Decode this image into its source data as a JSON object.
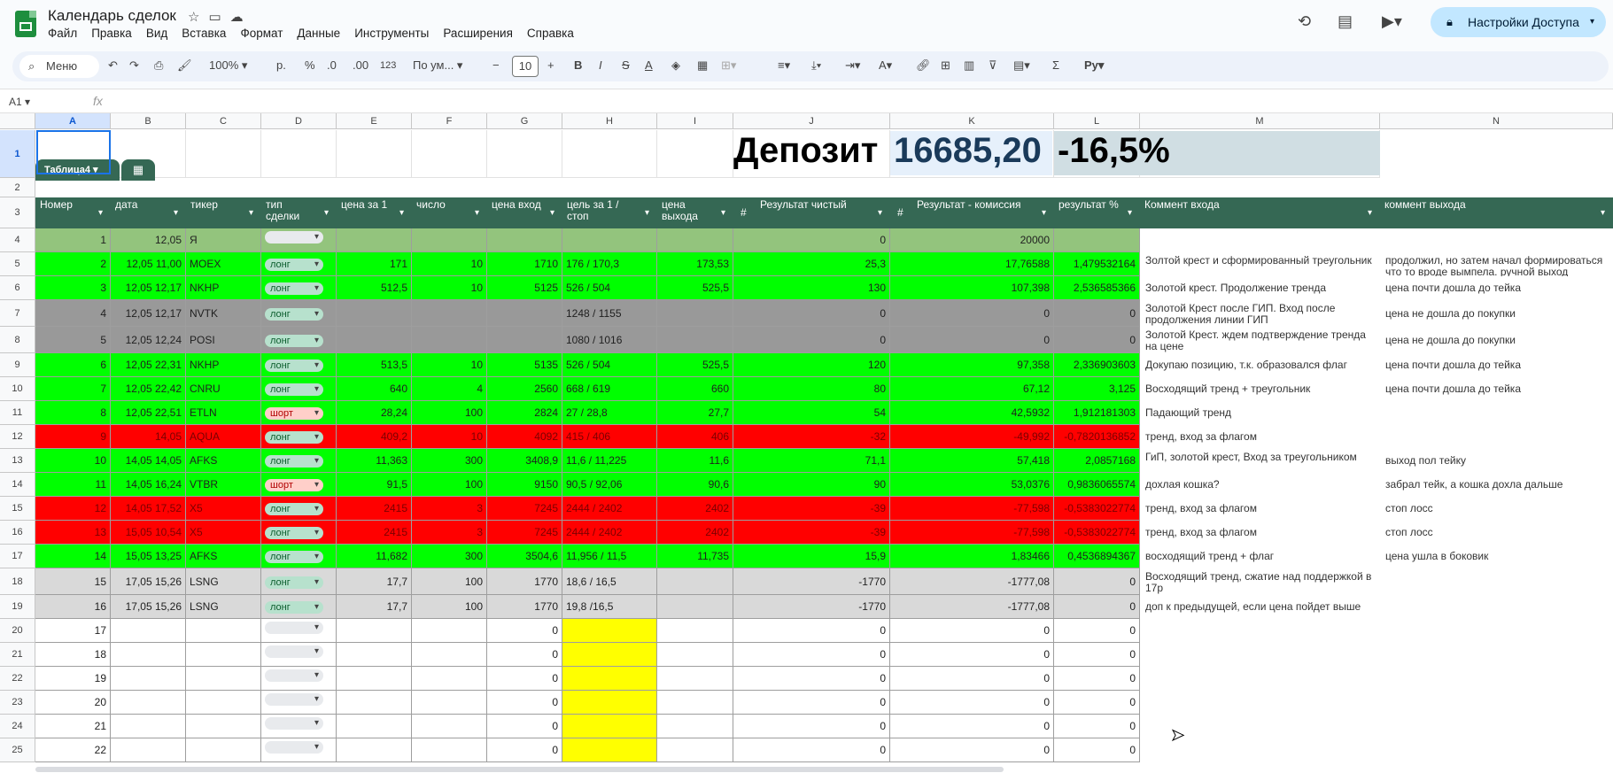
{
  "app": {
    "doc_title": "Календарь сделок",
    "menu": [
      "Файл",
      "Правка",
      "Вид",
      "Вставка",
      "Формат",
      "Данные",
      "Инструменты",
      "Расширения",
      "Справка"
    ],
    "share_label": "Настройки Доступа"
  },
  "toolbar": {
    "search_label": "Меню",
    "zoom": "100%",
    "currency": "р.",
    "percent": "%",
    "dec_dec": ".0",
    "dec_inc": ".00",
    "format_123": "123",
    "font": "По ум...",
    "font_size": "10"
  },
  "formula_bar": {
    "name_box": "A1",
    "fx": "fx"
  },
  "columns": [
    "A",
    "B",
    "C",
    "D",
    "E",
    "F",
    "G",
    "H",
    "I",
    "J",
    "K",
    "L",
    "M",
    "N"
  ],
  "row_numbers": [
    "1",
    "2",
    "3",
    "4",
    "5",
    "6",
    "7",
    "8",
    "9",
    "10",
    "11",
    "12",
    "13",
    "14",
    "15",
    "16",
    "17",
    "18",
    "19",
    "20",
    "21",
    "22",
    "23",
    "24",
    "25"
  ],
  "summary": {
    "deposit_label": "Депозит",
    "deposit_value": "16685,20",
    "deposit_pct": "-16,5%"
  },
  "table": {
    "name": "Таблица4",
    "headers": [
      "Номер",
      "дата",
      "тикер",
      "тип сделки",
      "цена за 1",
      "число",
      "цена вход",
      "цель за 1 / стоп",
      "цена выхода",
      "Результат чистый",
      "Результат - комиссия",
      "результат %",
      "Коммент входа",
      "коммент выхода"
    ],
    "rows": [
      {
        "n": "1",
        "date": "12,05",
        "ticker": "Я",
        "type": "",
        "price": "",
        "qty": "",
        "entry": "",
        "target": "",
        "exit": "",
        "net": "0",
        "fee": "20000",
        "pct": "",
        "c_in": "",
        "c_out": "",
        "color": "#93c47d"
      },
      {
        "n": "2",
        "date": "12,05 11,00",
        "ticker": "MOEX",
        "type": "лонг",
        "price": "171",
        "qty": "10",
        "entry": "1710",
        "target": "176 / 170,3",
        "exit": "173,53",
        "net": "25,3",
        "fee": "17,76588",
        "pct": "1,479532164",
        "c_in": "Золтой крест и сформированный треугольник",
        "c_out": "продолжил, но затем начал формироваться что то вроде вымпела. ручной выход",
        "color": "#00ff00"
      },
      {
        "n": "3",
        "date": "12,05 12,17",
        "ticker": "NKHP",
        "type": "лонг",
        "price": "512,5",
        "qty": "10",
        "entry": "5125",
        "target": "526 / 504",
        "exit": "525,5",
        "net": "130",
        "fee": "107,398",
        "pct": "2,536585366",
        "c_in": "Золотой крест. Продолжение тренда",
        "c_out": "цена почти дошла до тейка",
        "color": "#00ff00"
      },
      {
        "n": "4",
        "date": "12,05 12,17",
        "ticker": "NVTK",
        "type": "лонг",
        "price": "",
        "qty": "",
        "entry": "",
        "target": "1248 / 1155",
        "exit": "",
        "net": "0",
        "fee": "0",
        "pct": "0",
        "c_in": "Золотой Крест после ГИП. Вход после продолжения линии ГИП",
        "c_out": "цена не дошла до покупки",
        "color": "#999999"
      },
      {
        "n": "5",
        "date": "12,05 12,24",
        "ticker": "POSI",
        "type": "лонг",
        "price": "",
        "qty": "",
        "entry": "",
        "target": "1080 / 1016",
        "exit": "",
        "net": "0",
        "fee": "0",
        "pct": "0",
        "c_in": "Золотой Крест. ждем подтверждение тренда на цене",
        "c_out": "цена не дошла до покупки",
        "color": "#999999"
      },
      {
        "n": "6",
        "date": "12,05 22,31",
        "ticker": "NKHP",
        "type": "лонг",
        "price": "513,5",
        "qty": "10",
        "entry": "5135",
        "target": "526 / 504",
        "exit": "525,5",
        "net": "120",
        "fee": "97,358",
        "pct": "2,336903603",
        "c_in": "Докупаю позицию, т.к. образовался флаг",
        "c_out": "цена почти дошла до тейка",
        "color": "#00ff00"
      },
      {
        "n": "7",
        "date": "12,05 22,42",
        "ticker": "CNRU",
        "type": "лонг",
        "price": "640",
        "qty": "4",
        "entry": "2560",
        "target": "668 / 619",
        "exit": "660",
        "net": "80",
        "fee": "67,12",
        "pct": "3,125",
        "c_in": "Восходящий тренд + треугольник",
        "c_out": "цена почти дошла до тейка",
        "color": "#00ff00"
      },
      {
        "n": "8",
        "date": "12,05 22,51",
        "ticker": "ETLN",
        "type": "шорт",
        "price": "28,24",
        "qty": "100",
        "entry": "2824",
        "target": "27 / 28,8",
        "exit": "27,7",
        "net": "54",
        "fee": "42,5932",
        "pct": "1,912181303",
        "c_in": "Падающий тренд",
        "c_out": "",
        "color": "#00ff00"
      },
      {
        "n": "9",
        "date": "14,05",
        "ticker": "AQUA",
        "type": "лонг",
        "price": "409,2",
        "qty": "10",
        "entry": "4092",
        "target": "415 / 406",
        "exit": "406",
        "net": "-32",
        "fee": "-49,992",
        "pct": "-0,7820136852",
        "c_in": "тренд, вход за флагом",
        "c_out": "",
        "color": "#ff0000"
      },
      {
        "n": "10",
        "date": "14,05 14,05",
        "ticker": "AFKS",
        "type": "лонг",
        "price": "11,363",
        "qty": "300",
        "entry": "3408,9",
        "target": "11,6 / 11,225",
        "exit": "11,6",
        "net": "71,1",
        "fee": "57,418",
        "pct": "2,0857168",
        "c_in": "ГиП, золотой крест, Вход за треугольником",
        "c_out": "выход пол тейку",
        "color": "#00ff00"
      },
      {
        "n": "11",
        "date": "14,05 16,24",
        "ticker": "VTBR",
        "type": "шорт",
        "price": "91,5",
        "qty": "100",
        "entry": "9150",
        "target": "90,5 / 92,06",
        "exit": "90,6",
        "net": "90",
        "fee": "53,0376",
        "pct": "0,9836065574",
        "c_in": "дохлая кошка?",
        "c_out": "забрал тейк, а кошка дохла дальше",
        "color": "#00ff00"
      },
      {
        "n": "12",
        "date": "14,05 17,52",
        "ticker": "X5",
        "type": "лонг",
        "price": "2415",
        "qty": "3",
        "entry": "7245",
        "target": "2444 / 2402",
        "exit": "2402",
        "net": "-39",
        "fee": "-77,598",
        "pct": "-0,5383022774",
        "c_in": "тренд, вход за флагом",
        "c_out": "стоп лосс",
        "color": "#ff0000"
      },
      {
        "n": "13",
        "date": "15,05 10,54",
        "ticker": "X5",
        "type": "лонг",
        "price": "2415",
        "qty": "3",
        "entry": "7245",
        "target": "2444 / 2402",
        "exit": "2402",
        "net": "-39",
        "fee": "-77,598",
        "pct": "-0,5383022774",
        "c_in": "тренд, вход за флагом",
        "c_out": "стоп лосс",
        "color": "#ff0000"
      },
      {
        "n": "14",
        "date": "15,05 13,25",
        "ticker": "AFKS",
        "type": "лонг",
        "price": "11,682",
        "qty": "300",
        "entry": "3504,6",
        "target": "11,956 / 11,5",
        "exit": "11,735",
        "net": "15,9",
        "fee": "1,83466",
        "pct": "0,4536894367",
        "c_in": "восходящий тренд + флаг",
        "c_out": "цена ушла в боковик",
        "color": "#00ff00"
      },
      {
        "n": "15",
        "date": "17,05 15,26",
        "ticker": "LSNG",
        "type": "лонг",
        "price": "17,7",
        "qty": "100",
        "entry": "1770",
        "target": "18,6 / 16,5",
        "exit": "",
        "net": "-1770",
        "fee": "-1777,08",
        "pct": "0",
        "c_in": "Восходящий тренд, сжатие над поддержкой в 17р",
        "c_out": "",
        "color": "#d9d9d9"
      },
      {
        "n": "16",
        "date": "17,05 15,26",
        "ticker": "LSNG",
        "type": "лонг",
        "price": "17,7",
        "qty": "100",
        "entry": "1770",
        "target": "19,8 /16,5",
        "exit": "",
        "net": "-1770",
        "fee": "-1777,08",
        "pct": "0",
        "c_in": "доп к предыдущей, если цена пойдет выше",
        "c_out": "",
        "color": "#d9d9d9"
      },
      {
        "n": "17",
        "date": "",
        "ticker": "",
        "type": "",
        "price": "",
        "qty": "",
        "entry": "0",
        "target": "",
        "exit": "",
        "net": "0",
        "fee": "0",
        "pct": "0",
        "c_in": "",
        "c_out": "",
        "color": "#ffffff"
      },
      {
        "n": "18",
        "date": "",
        "ticker": "",
        "type": "",
        "price": "",
        "qty": "",
        "entry": "0",
        "target": "",
        "exit": "",
        "net": "0",
        "fee": "0",
        "pct": "0",
        "c_in": "",
        "c_out": "",
        "color": "#ffffff"
      },
      {
        "n": "19",
        "date": "",
        "ticker": "",
        "type": "",
        "price": "",
        "qty": "",
        "entry": "0",
        "target": "",
        "exit": "",
        "net": "0",
        "fee": "0",
        "pct": "0",
        "c_in": "",
        "c_out": "",
        "color": "#ffffff"
      },
      {
        "n": "20",
        "date": "",
        "ticker": "",
        "type": "",
        "price": "",
        "qty": "",
        "entry": "0",
        "target": "",
        "exit": "",
        "net": "0",
        "fee": "0",
        "pct": "0",
        "c_in": "",
        "c_out": "",
        "color": "#ffffff"
      },
      {
        "n": "21",
        "date": "",
        "ticker": "",
        "type": "",
        "price": "",
        "qty": "",
        "entry": "0",
        "target": "",
        "exit": "",
        "net": "0",
        "fee": "0",
        "pct": "0",
        "c_in": "",
        "c_out": "",
        "color": "#ffffff"
      },
      {
        "n": "22",
        "date": "",
        "ticker": "",
        "type": "",
        "price": "",
        "qty": "",
        "entry": "0",
        "target": "",
        "exit": "",
        "net": "0",
        "fee": "0",
        "pct": "0",
        "c_in": "",
        "c_out": "",
        "color": "#ffffff"
      }
    ]
  },
  "colors": {
    "header_green": "#356854",
    "positive": "#00ff00",
    "negative": "#ff0000",
    "skipped": "#999999",
    "open": "#d9d9d9",
    "target_empty": "#ffff00",
    "long_chip": "#b7e1cd",
    "short_chip": "#ffcfc9"
  }
}
